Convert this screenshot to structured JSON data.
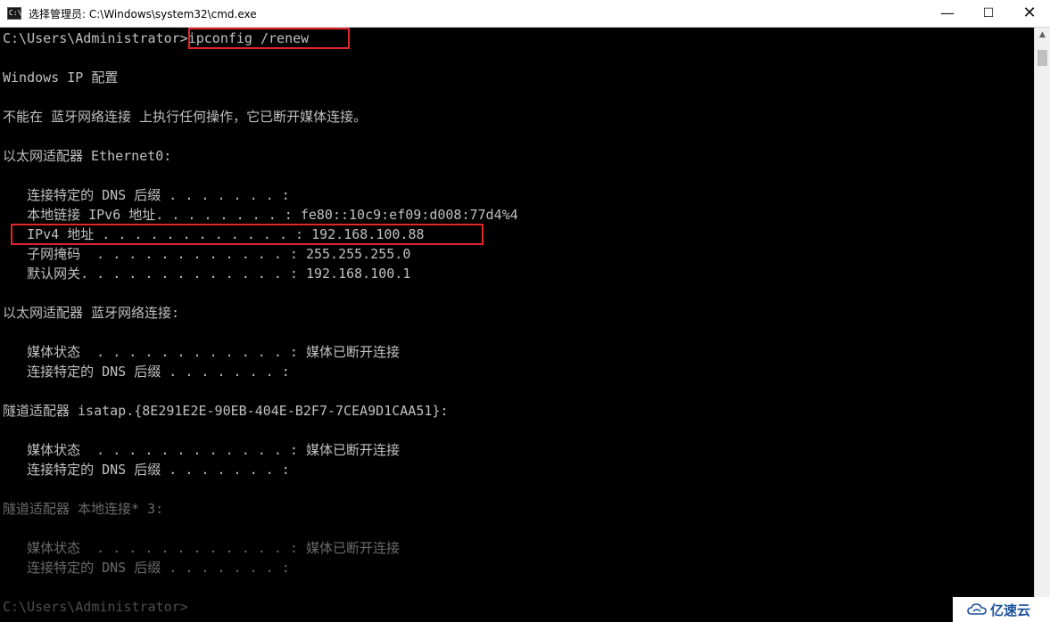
{
  "window": {
    "title": "选择管理员: C:\\Windows\\system32\\cmd.exe",
    "icon": "cmd-icon",
    "icon_text": "C:\\",
    "controls": {
      "minimize": "—",
      "maximize": "☐",
      "close": "✕"
    }
  },
  "console": {
    "lines": [
      "C:\\Users\\Administrator>ipconfig /renew",
      "",
      "Windows IP 配置",
      "",
      "不能在 蓝牙网络连接 上执行任何操作，它已断开媒体连接。",
      "",
      "以太网适配器 Ethernet0:",
      "",
      "   连接特定的 DNS 后缀 . . . . . . . :",
      "   本地链接 IPv6 地址. . . . . . . . : fe80::10c9:ef09:d008:77d4%4",
      "   IPv4 地址 . . . . . . . . . . . . : 192.168.100.88",
      "   子网掩码  . . . . . . . . . . . . : 255.255.255.0",
      "   默认网关. . . . . . . . . . . . . : 192.168.100.1",
      "",
      "以太网适配器 蓝牙网络连接:",
      "",
      "   媒体状态  . . . . . . . . . . . . : 媒体已断开连接",
      "   连接特定的 DNS 后缀 . . . . . . . :",
      "",
      "隧道适配器 isatap.{8E291E2E-90EB-404E-B2F7-7CEA9D1CAA51}:",
      "",
      "   媒体状态  . . . . . . . . . . . . : 媒体已断开连接",
      "   连接特定的 DNS 后缀 . . . . . . . :",
      "",
      "隧道适配器 本地连接* 3:",
      "",
      "   媒体状态  . . . . . . . . . . . . : 媒体已断开连接",
      "   连接特定的 DNS 后缀 . . . . . . . :",
      "",
      "C:\\Users\\Administrator>"
    ]
  },
  "highlight_color": "#e3262b",
  "scrollbar": {
    "up_arrow": "▲",
    "down_arrow": "▼"
  },
  "watermark": {
    "text": "亿速云",
    "icon": "cloud-logo-icon"
  }
}
